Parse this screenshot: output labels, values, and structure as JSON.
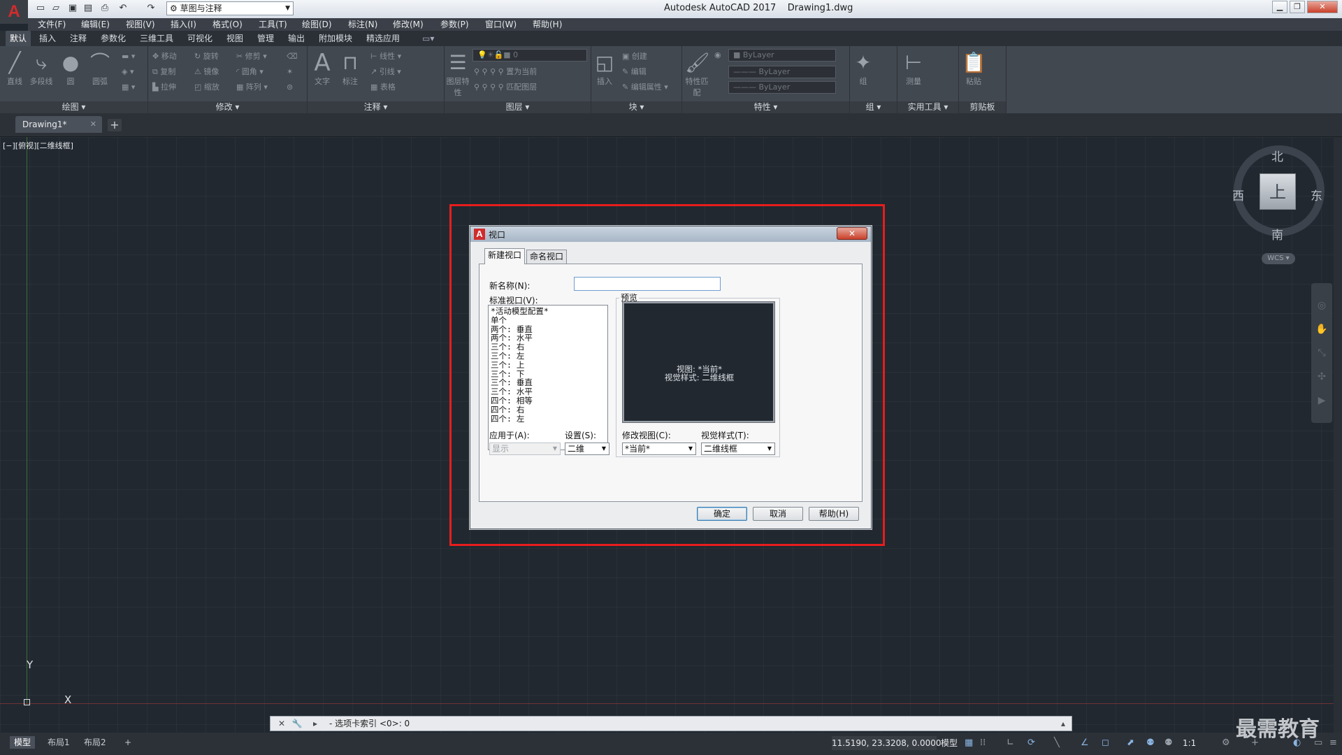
{
  "app": {
    "title": "Autodesk AutoCAD 2017",
    "file": "Drawing1.dwg",
    "workspace": "草图与注释",
    "logo_letter": "A"
  },
  "menubar": [
    "文件(F)",
    "编辑(E)",
    "视图(V)",
    "插入(I)",
    "格式(O)",
    "工具(T)",
    "绘图(D)",
    "标注(N)",
    "修改(M)",
    "参数(P)",
    "窗口(W)",
    "帮助(H)"
  ],
  "ribbon_tabs": [
    "默认",
    "插入",
    "注释",
    "参数化",
    "三维工具",
    "可视化",
    "视图",
    "管理",
    "输出",
    "附加模块",
    "精选应用"
  ],
  "ribbon": {
    "draw": {
      "title": "绘图",
      "line": "直线",
      "pline": "多段线",
      "circle": "圆",
      "arc": "圆弧"
    },
    "modify": {
      "title": "修改",
      "items": [
        "移动",
        "旋转",
        "修剪",
        "复制",
        "镜像",
        "圆角",
        "拉伸",
        "缩放",
        "阵列"
      ]
    },
    "annotation": {
      "title": "注释",
      "text": "文字",
      "dim": "标注",
      "linear": "线性",
      "leader": "引线",
      "table": "表格"
    },
    "layers": {
      "title": "图层",
      "layer_props": "图层特性",
      "current": "0",
      "match": "置为当前",
      "match2": "匹配图层"
    },
    "block": {
      "title": "块",
      "insert": "插入",
      "create": "创建",
      "edit": "编辑",
      "attr": "编辑属性"
    },
    "properties": {
      "title": "特性",
      "match": "特性匹配",
      "color": "ByLayer",
      "linetype": "ByLayer",
      "lineweight": "ByLayer"
    },
    "groups": {
      "title": "组",
      "group": "组"
    },
    "utilities": {
      "title": "实用工具",
      "measure": "测量"
    },
    "clipboard": {
      "title": "剪贴板",
      "paste": "粘贴"
    }
  },
  "doc_tab": {
    "name": "Drawing1*"
  },
  "viewport_label": "[−][俯视][二维线框]",
  "viewcube": {
    "top": "上",
    "north": "北",
    "south": "南",
    "east": "东",
    "west": "西",
    "wcs": "WCS"
  },
  "ucs": {
    "x": "X",
    "y": "Y"
  },
  "dialog": {
    "title": "视口",
    "tabs": [
      "新建视口",
      "命名视口"
    ],
    "new_name_label": "新名称(N):",
    "new_name_value": "",
    "std_label": "标准视口(V):",
    "std_list": [
      "*活动模型配置*",
      "单个",
      "两个: 垂直",
      "两个: 水平",
      "三个: 右",
      "三个: 左",
      "三个: 上",
      "三个: 下",
      "三个: 垂直",
      "三个: 水平",
      "四个: 相等",
      "四个: 右",
      "四个: 左"
    ],
    "preview_label": "预览",
    "preview_line1": "视图: *当前*",
    "preview_line2": "视觉样式: 二维线框",
    "apply_label": "应用于(A):",
    "apply_value": "显示",
    "setup_label": "设置(S):",
    "setup_value": "二维",
    "change_view_label": "修改视图(C):",
    "change_view_value": "*当前*",
    "visual_style_label": "视觉样式(T):",
    "visual_style_value": "二维线框",
    "ok": "确定",
    "cancel": "取消",
    "help": "帮助(H)"
  },
  "command_line": {
    "text": "- 选项卡索引 <0>: 0"
  },
  "layout_tabs": [
    "模型",
    "布局1",
    "布局2"
  ],
  "status": {
    "coords": "11.5190, 23.3208, 0.0000",
    "model": "模型",
    "scale": "1:1"
  },
  "watermark": "最需教育"
}
